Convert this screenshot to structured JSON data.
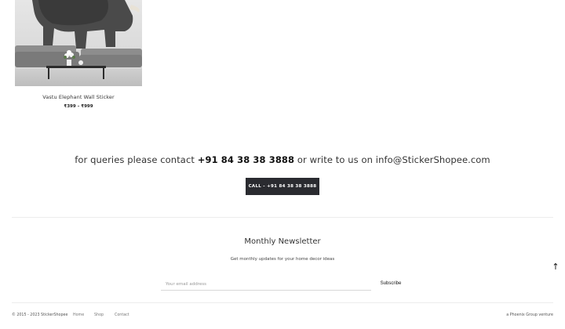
{
  "product": {
    "title": "Vastu Elephant Wall Sticker",
    "price": "₹399 – ₹999"
  },
  "contact": {
    "prefix": "for queries please contact ",
    "phone": "+91 84 38 38 3888",
    "middle": " or write to us on ",
    "email": "info@StickerShopee.com",
    "button_label": "CALL - +91 84 38 38 3888"
  },
  "newsletter": {
    "heading": "Monthly Newsletter",
    "subtext": "Get monthly updates for your home decor ideas",
    "email_placeholder": "Your email address",
    "subscribe_label": "Subscribe"
  },
  "back_to_top_icon": "arrow-up-icon",
  "back_to_top_glyph": "↑",
  "footer": {
    "copyright": "© 2015 - 2023 StickerShopee",
    "links": [
      "Home",
      "Shop",
      "Contact"
    ],
    "tagline": "a Phoenix Group venture"
  }
}
